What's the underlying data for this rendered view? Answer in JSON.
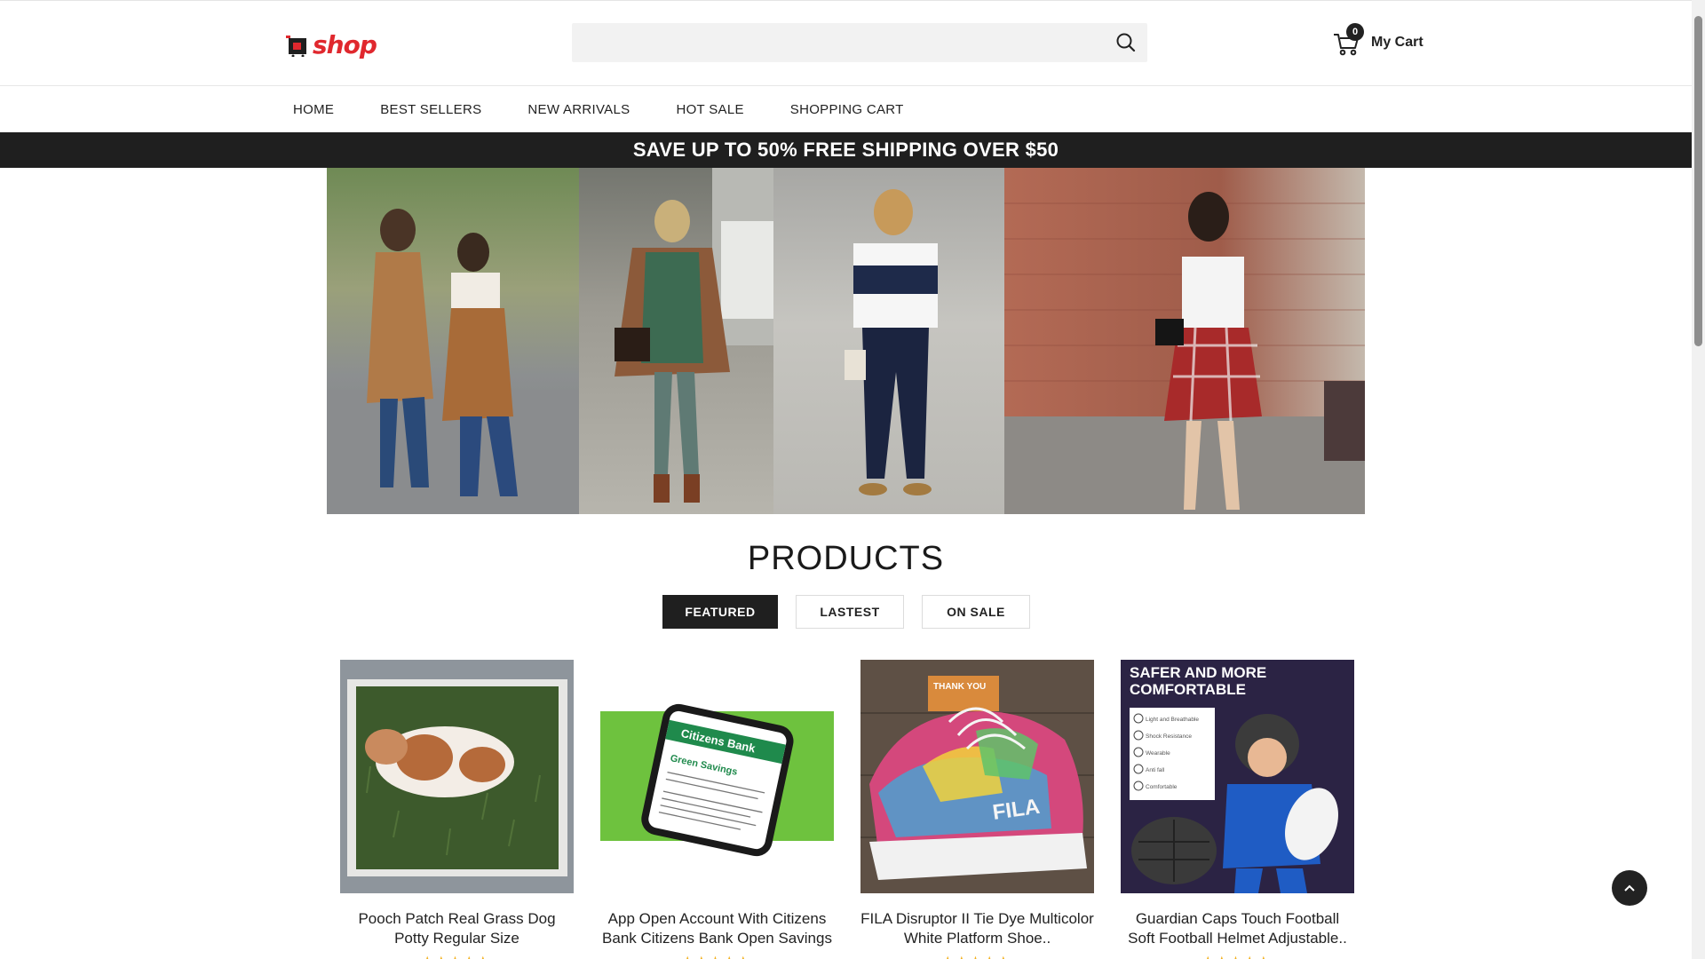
{
  "logo": {
    "text": "shop"
  },
  "search": {
    "placeholder": ""
  },
  "cart": {
    "count": "0",
    "label": "My Cart"
  },
  "nav": {
    "items": [
      {
        "label": "HOME"
      },
      {
        "label": "BEST SELLERS"
      },
      {
        "label": "NEW ARRIVALS"
      },
      {
        "label": "HOT SALE"
      },
      {
        "label": "SHOPPING CART"
      }
    ]
  },
  "promo": {
    "text": "SAVE UP TO 50% FREE SHIPPING OVER $50"
  },
  "products": {
    "title": "PRODUCTS",
    "tabs": [
      {
        "label": "FEATURED"
      },
      {
        "label": "LASTEST"
      },
      {
        "label": "ON SALE"
      }
    ],
    "items": [
      {
        "title": "Pooch Patch Real Grass Dog Potty Regular Size",
        "rating": "★★★★★"
      },
      {
        "title": "App Open Account With Citizens Bank Citizens Bank Open Savings",
        "rating": "★★★★★"
      },
      {
        "title": "FILA Disruptor II Tie Dye Multicolor White Platform Shoe..",
        "rating": "★★★★★"
      },
      {
        "title": "Guardian Caps Touch Football Soft Football Helmet Adjustable..",
        "rating": "★★★★★"
      }
    ],
    "image_text": {
      "bank_brand": "Citizens Bank",
      "bank_offer": "Green Savings",
      "sneaker_tag": "THANK YOU",
      "sneaker_brand": "FILA",
      "helmet_headline_1": "SAFER AND MORE",
      "helmet_headline_2": "COMFORTABLE",
      "helmet_features": [
        "Light and Breathable",
        "Shock Resistance",
        "Wearable",
        "Anti fall",
        "Comfortable"
      ]
    }
  },
  "colors": {
    "accent": "#e0282e",
    "dark": "#1f1f1f",
    "star": "#f2b01e"
  }
}
